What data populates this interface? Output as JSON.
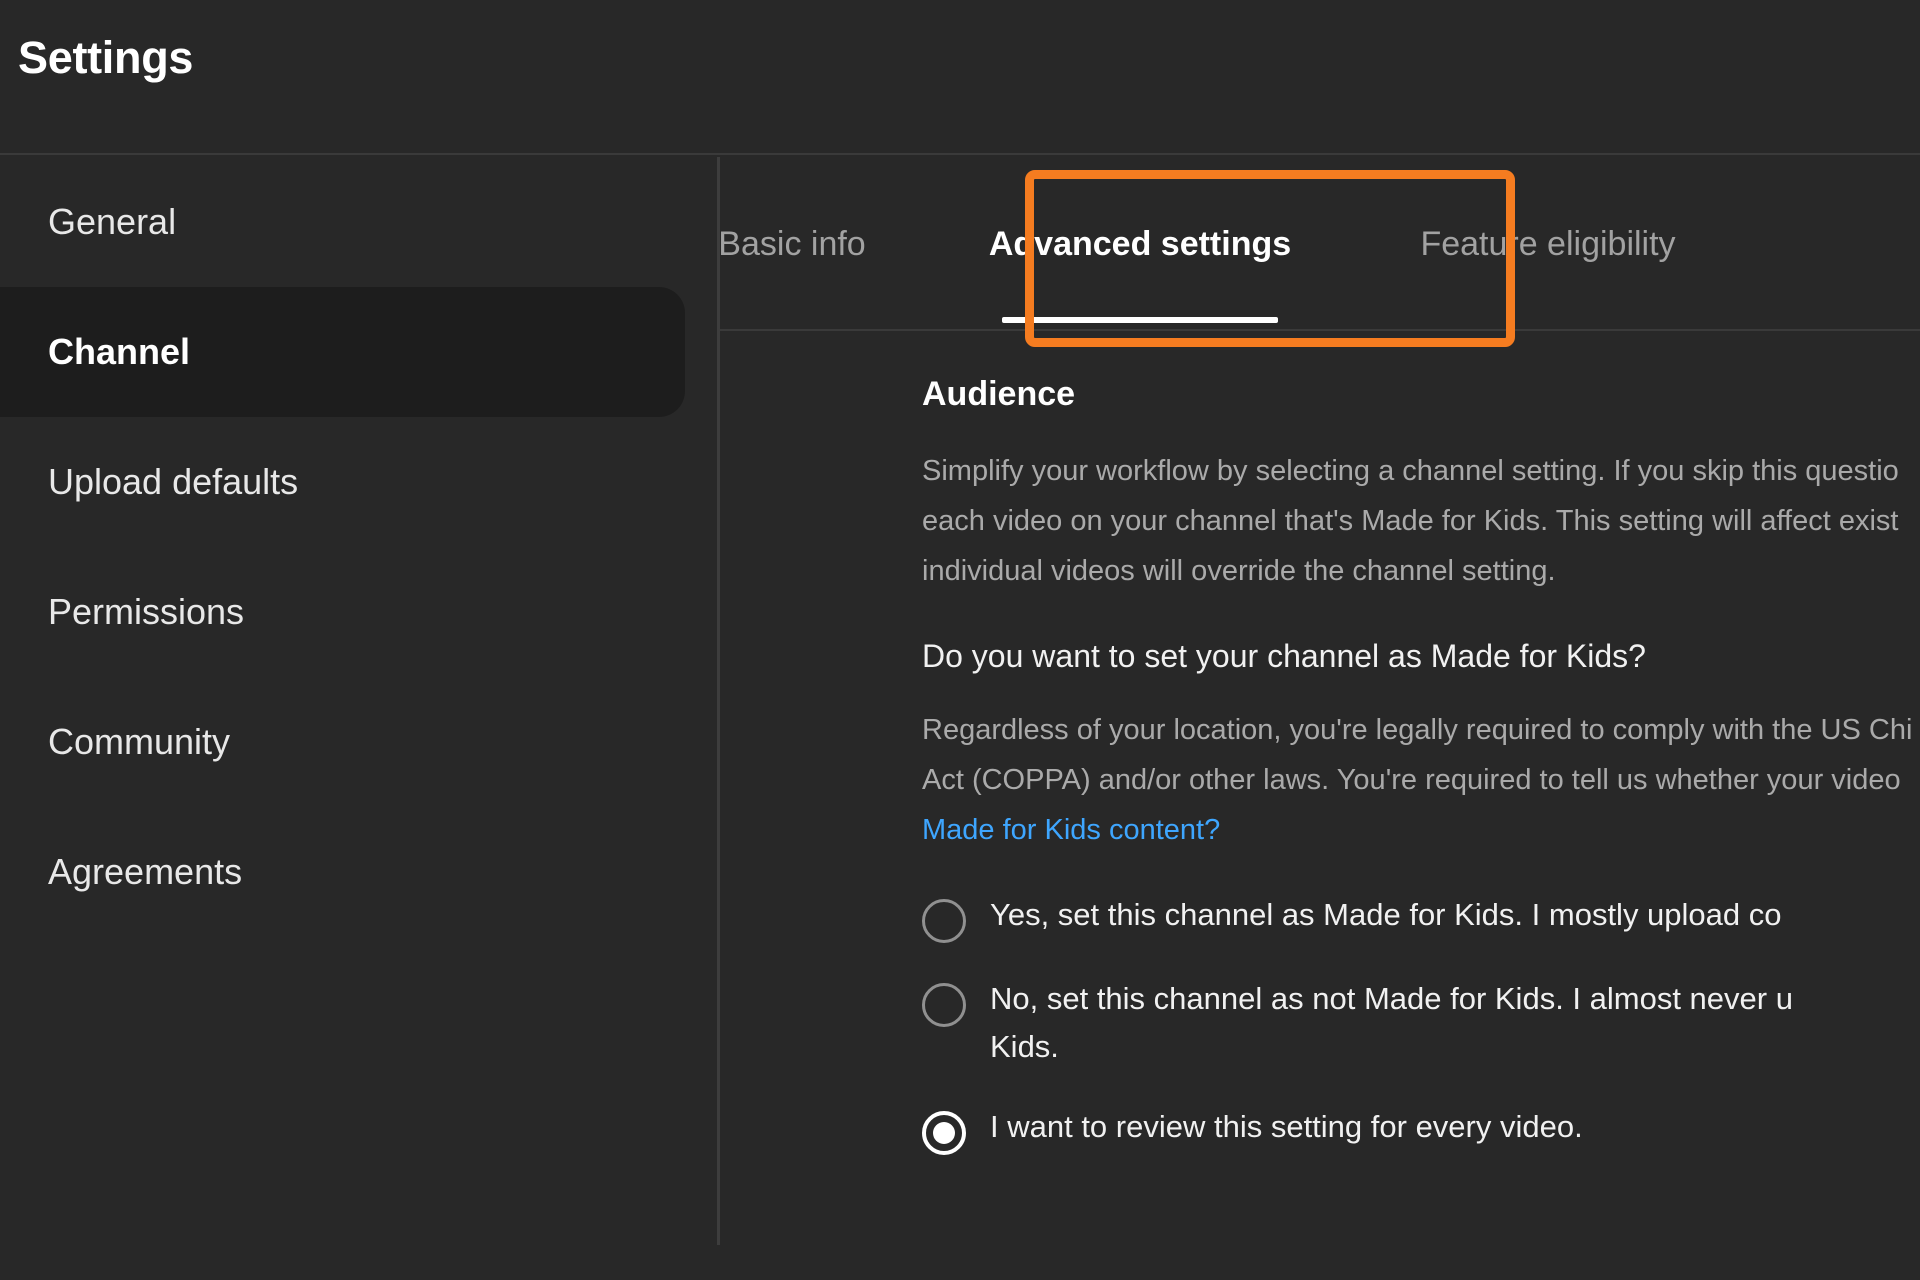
{
  "header": {
    "title": "Settings"
  },
  "sidebar": {
    "items": [
      {
        "label": "General",
        "selected": false
      },
      {
        "label": "Channel",
        "selected": true
      },
      {
        "label": "Upload defaults",
        "selected": false
      },
      {
        "label": "Permissions",
        "selected": false
      },
      {
        "label": "Community",
        "selected": false
      },
      {
        "label": "Agreements",
        "selected": false
      }
    ]
  },
  "tabs": [
    {
      "label": "Basic info",
      "active": false
    },
    {
      "label": "Advanced settings",
      "active": true
    },
    {
      "label": "Feature eligibility",
      "active": false
    }
  ],
  "annotation": {
    "target": "Advanced settings",
    "color": "#f57c20"
  },
  "main": {
    "section_title": "Audience",
    "description_lines": [
      "Simplify your workflow by selecting a channel setting. If you skip this questio",
      "each video on your channel that's Made for Kids. This setting will affect exist",
      "individual videos will override the channel setting."
    ],
    "question": "Do you want to set your channel as Made for Kids?",
    "legal_lines": [
      "Regardless of your location, you're legally required to comply with the US Chi",
      "Act (COPPA) and/or other laws. You're required to tell us whether your video"
    ],
    "legal_link": "Made for Kids content?",
    "options": [
      {
        "lines": [
          "Yes, set this channel as Made for Kids. I mostly upload co"
        ],
        "checked": false
      },
      {
        "lines": [
          "No, set this channel as not Made for Kids. I almost never u",
          "Kids."
        ],
        "checked": false
      },
      {
        "lines": [
          "I want to review this setting for every video."
        ],
        "checked": true
      }
    ]
  },
  "colors": {
    "page_background": "#282828",
    "selected_nav_background": "#1d1d1d",
    "accent_link": "#3ea6ff",
    "annotation_orange": "#f57c20",
    "active_tab_text": "#ffffff",
    "inactive_tab_text": "#a2a2a2",
    "muted_text": "#aaaaaa"
  }
}
